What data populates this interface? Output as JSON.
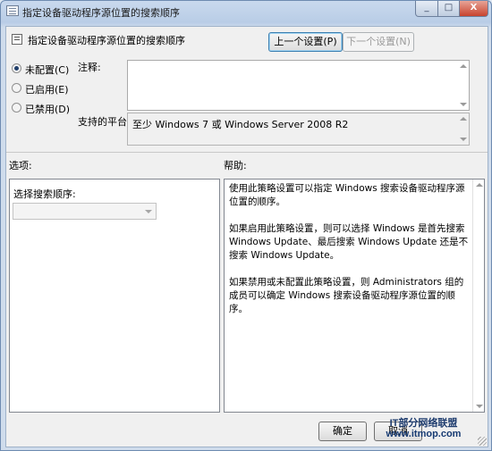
{
  "window": {
    "title": "指定设备驱动程序源位置的搜索顺序",
    "close_glyph": "X"
  },
  "header": {
    "setting_name": "指定设备驱动程序源位置的搜索顺序",
    "prev_button": "上一个设置(P)",
    "next_button": "下一个设置(N)"
  },
  "state": {
    "options": [
      {
        "label": "未配置(C)",
        "checked": true
      },
      {
        "label": "已启用(E)",
        "checked": false
      },
      {
        "label": "已禁用(D)",
        "checked": false
      }
    ]
  },
  "comment": {
    "label": "注释:",
    "value": ""
  },
  "platform": {
    "label": "支持的平台:",
    "value": "至少 Windows 7 或 Windows Server 2008 R2"
  },
  "options_panel": {
    "title": "选项:",
    "search_order_label": "选择搜索顺序:",
    "search_order_value": ""
  },
  "help_panel": {
    "title": "帮助:",
    "paragraphs": [
      "使用此策略设置可以指定 Windows 搜索设备驱动程序源位置的顺序。",
      "如果启用此策略设置，则可以选择 Windows 是首先搜索 Windows Update、最后搜索 Windows Update 还是不搜索 Windows Update。",
      "如果禁用或未配置此策略设置，则 Administrators 组的成员可以确定 Windows 搜索设备驱动程序源位置的顺序。"
    ]
  },
  "footer": {
    "ok_button": "确定",
    "cancel_button": "取消"
  },
  "watermark": {
    "line1": "IT部分网络联盟",
    "line2": "www.itmop.com"
  }
}
